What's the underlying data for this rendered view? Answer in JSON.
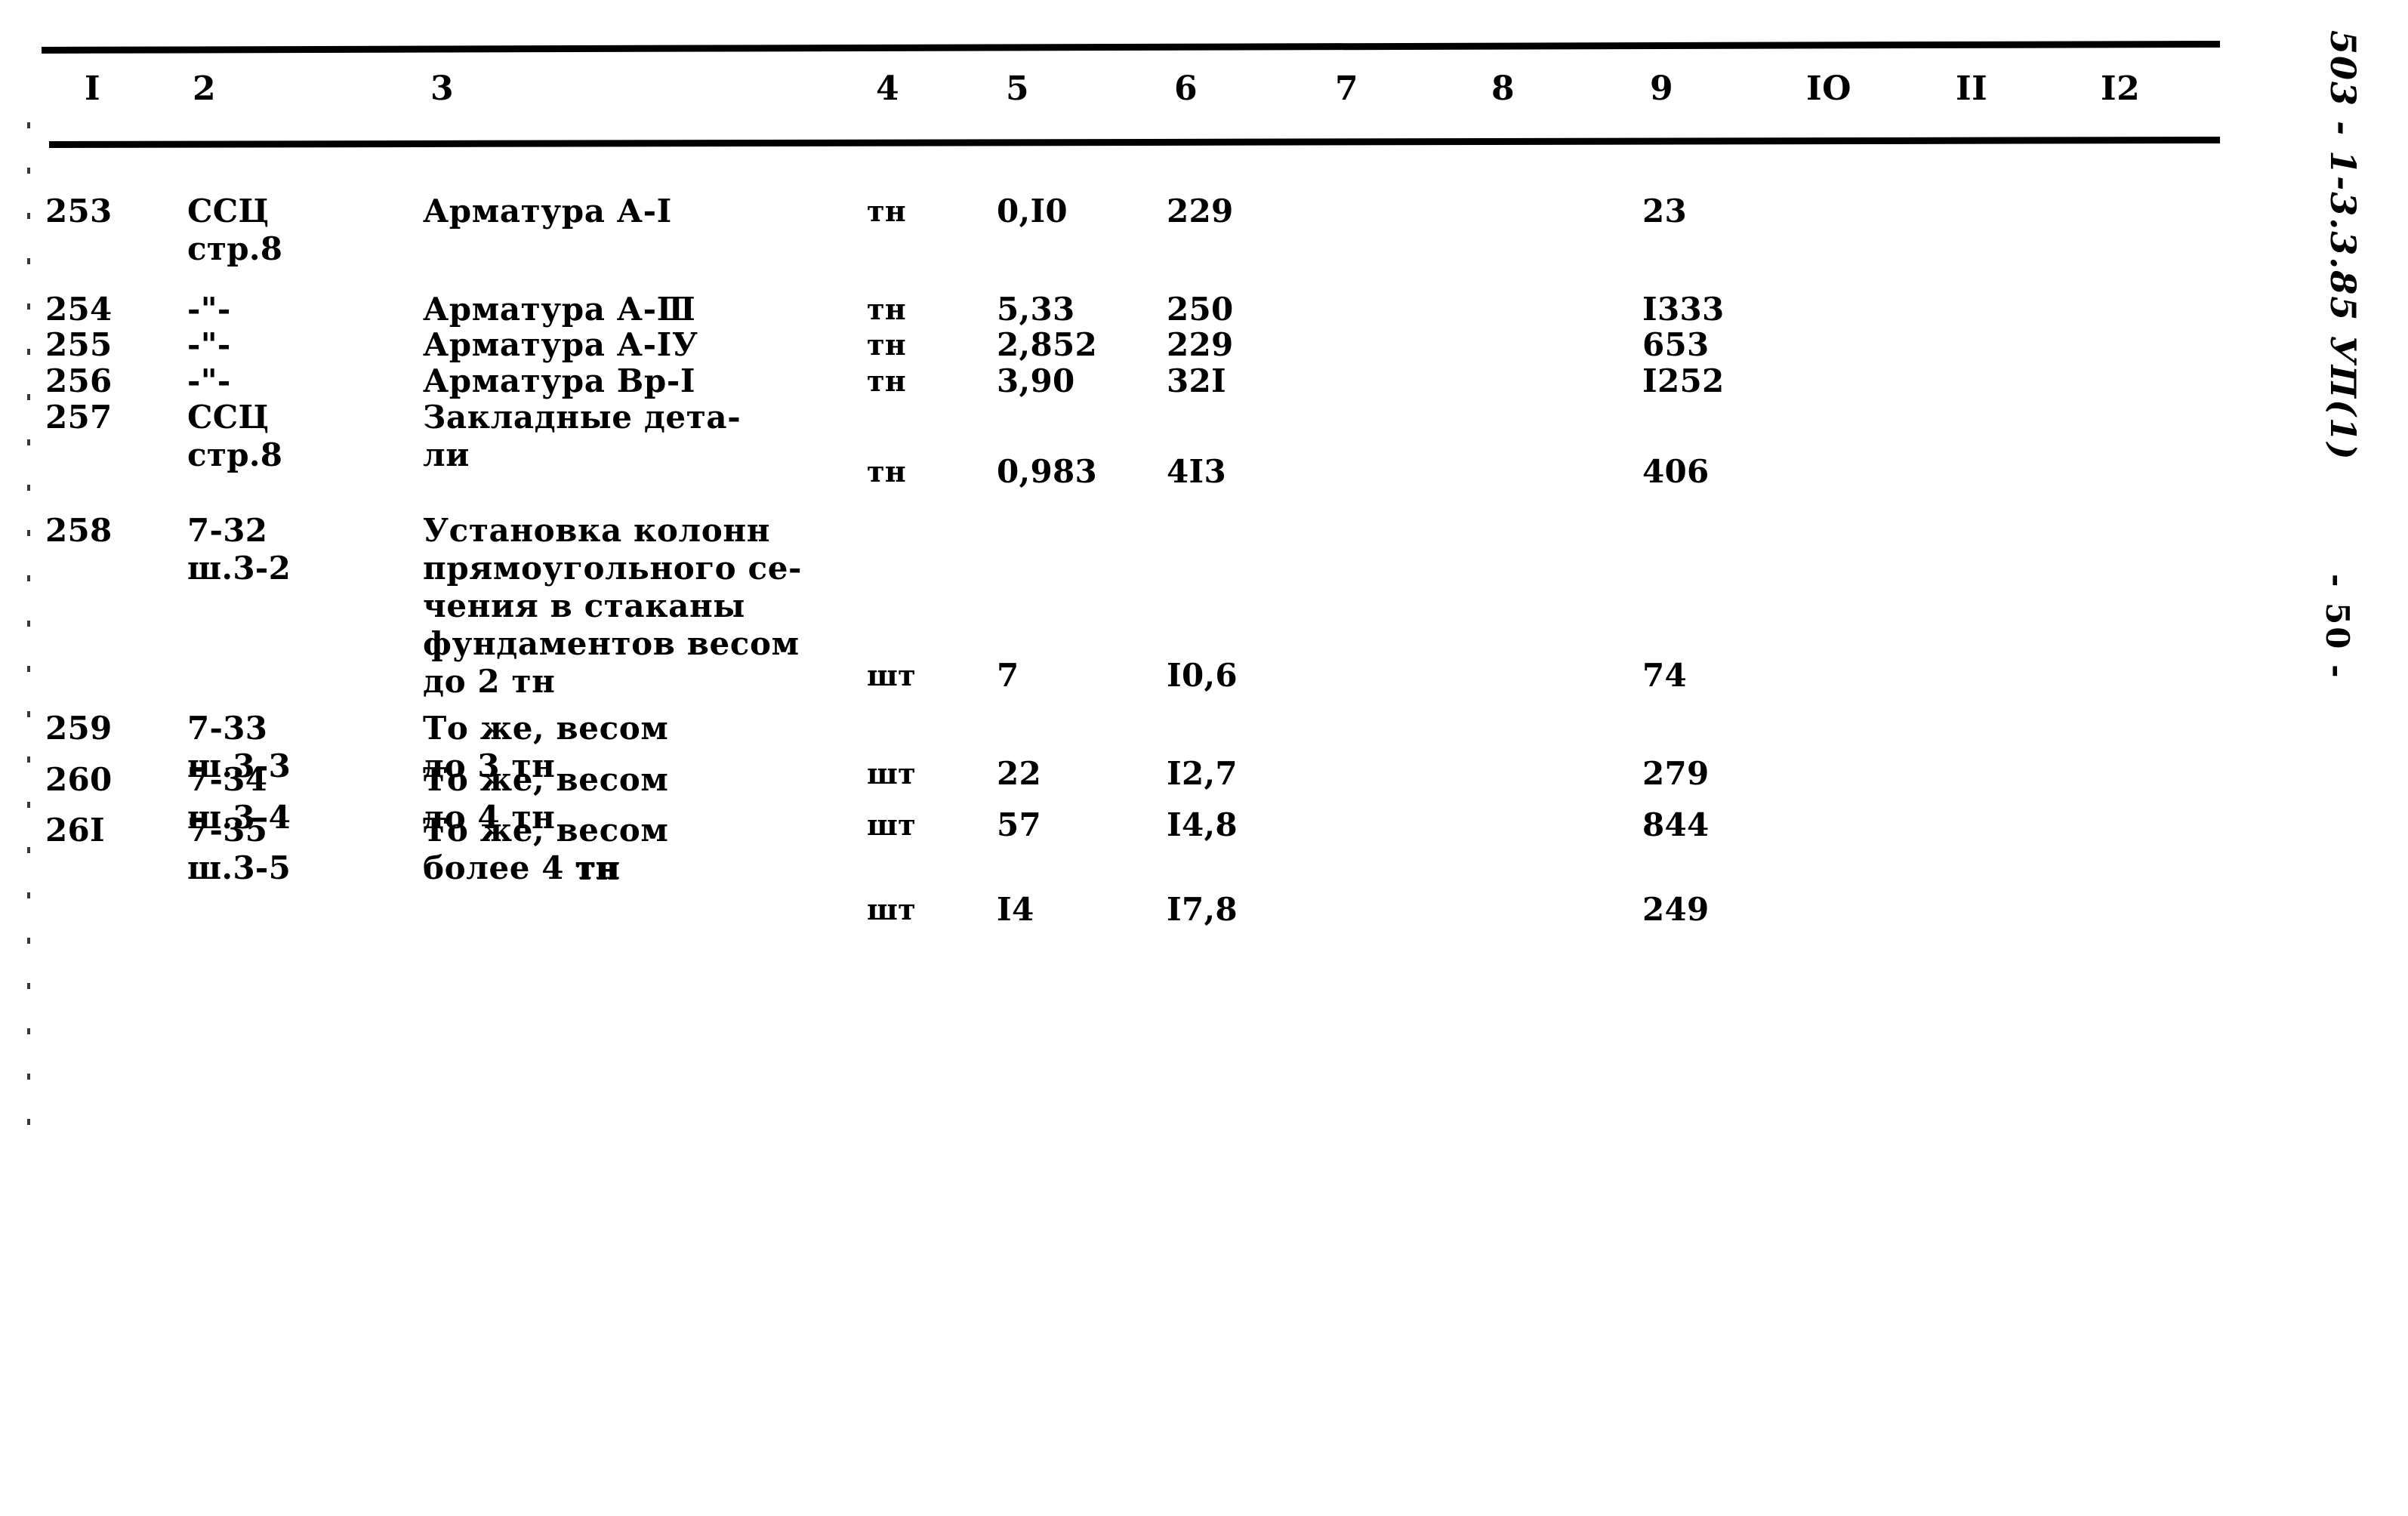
{
  "document": {
    "code": "503 - 1-3.3.85 УП(1)",
    "page_number": "- 50 -"
  },
  "table": {
    "column_headers": [
      "I",
      "2",
      "3",
      "4",
      "5",
      "6",
      "7",
      "8",
      "9",
      "IO",
      "II",
      "I2"
    ],
    "rows": [
      {
        "c1": "253",
        "c2": "ССЦ\nстр.8",
        "c3": "Арматура А-I",
        "c4": "тн",
        "c5": "0,I0",
        "c6": "229",
        "c7": "",
        "c8": "",
        "c9": "23",
        "c10": "",
        "c11": "",
        "c12": ""
      },
      {
        "c1": "254",
        "c2": "-\"-",
        "c3": "Арматура А-Ⅲ",
        "c4": "тн",
        "c5": "5,33",
        "c6": "250",
        "c7": "",
        "c8": "",
        "c9": "I333",
        "c10": "",
        "c11": "",
        "c12": ""
      },
      {
        "c1": "255",
        "c2": "-\"-",
        "c3": "Арматура А-IУ",
        "c4": "тн",
        "c5": "2,852",
        "c6": "229",
        "c7": "",
        "c8": "",
        "c9": "653",
        "c10": "",
        "c11": "",
        "c12": ""
      },
      {
        "c1": "256",
        "c2": "-\"-",
        "c3": "Арматура Вр-I",
        "c4": "тн",
        "c5": "3,90",
        "c6": "32I",
        "c7": "",
        "c8": "",
        "c9": "I252",
        "c10": "",
        "c11": "",
        "c12": ""
      },
      {
        "c1": "257",
        "c2": "ССЦ\nстр.8",
        "c3": "Закладные дета-\nли",
        "c4": "тн",
        "c5": "0,983",
        "c6": "4I3",
        "c7": "",
        "c8": "",
        "c9": "406",
        "c10": "",
        "c11": "",
        "c12": ""
      },
      {
        "c1": "258",
        "c2": "7-32\nш.3-2",
        "c3": "Установка колонн\nпрямоугольного се-\nчения в стаканы\nфундаментов весом\nдо 2 тн",
        "c4": "шт",
        "c5": "7",
        "c6": "I0,6",
        "c7": "",
        "c8": "",
        "c9": "74",
        "c10": "",
        "c11": "",
        "c12": ""
      },
      {
        "c1": "259",
        "c2": "7-33\nш.3-3",
        "c3": "То же, весом\nдо 3 тн",
        "c4": "шт",
        "c5": "22",
        "c6": "I2,7",
        "c7": "",
        "c8": "",
        "c9": "279",
        "c10": "",
        "c11": "",
        "c12": ""
      },
      {
        "c1": "260",
        "c2": "7-34\nш.3-4",
        "c3": "То же, весом\nдо 4 тн",
        "c4": "шт",
        "c5": "57",
        "c6": "I4,8",
        "c7": "",
        "c8": "",
        "c9": "844",
        "c10": "",
        "c11": "",
        "c12": ""
      },
      {
        "c1": "26I",
        "c2": "7-35\nш.3-5",
        "c3": "То же, весом\nболее 4 тн",
        "c4": "шт",
        "c5": "I4",
        "c6": "I7,8",
        "c7": "",
        "c8": "",
        "c9": "249",
        "c10": "",
        "c11": "",
        "c12": ""
      }
    ]
  }
}
